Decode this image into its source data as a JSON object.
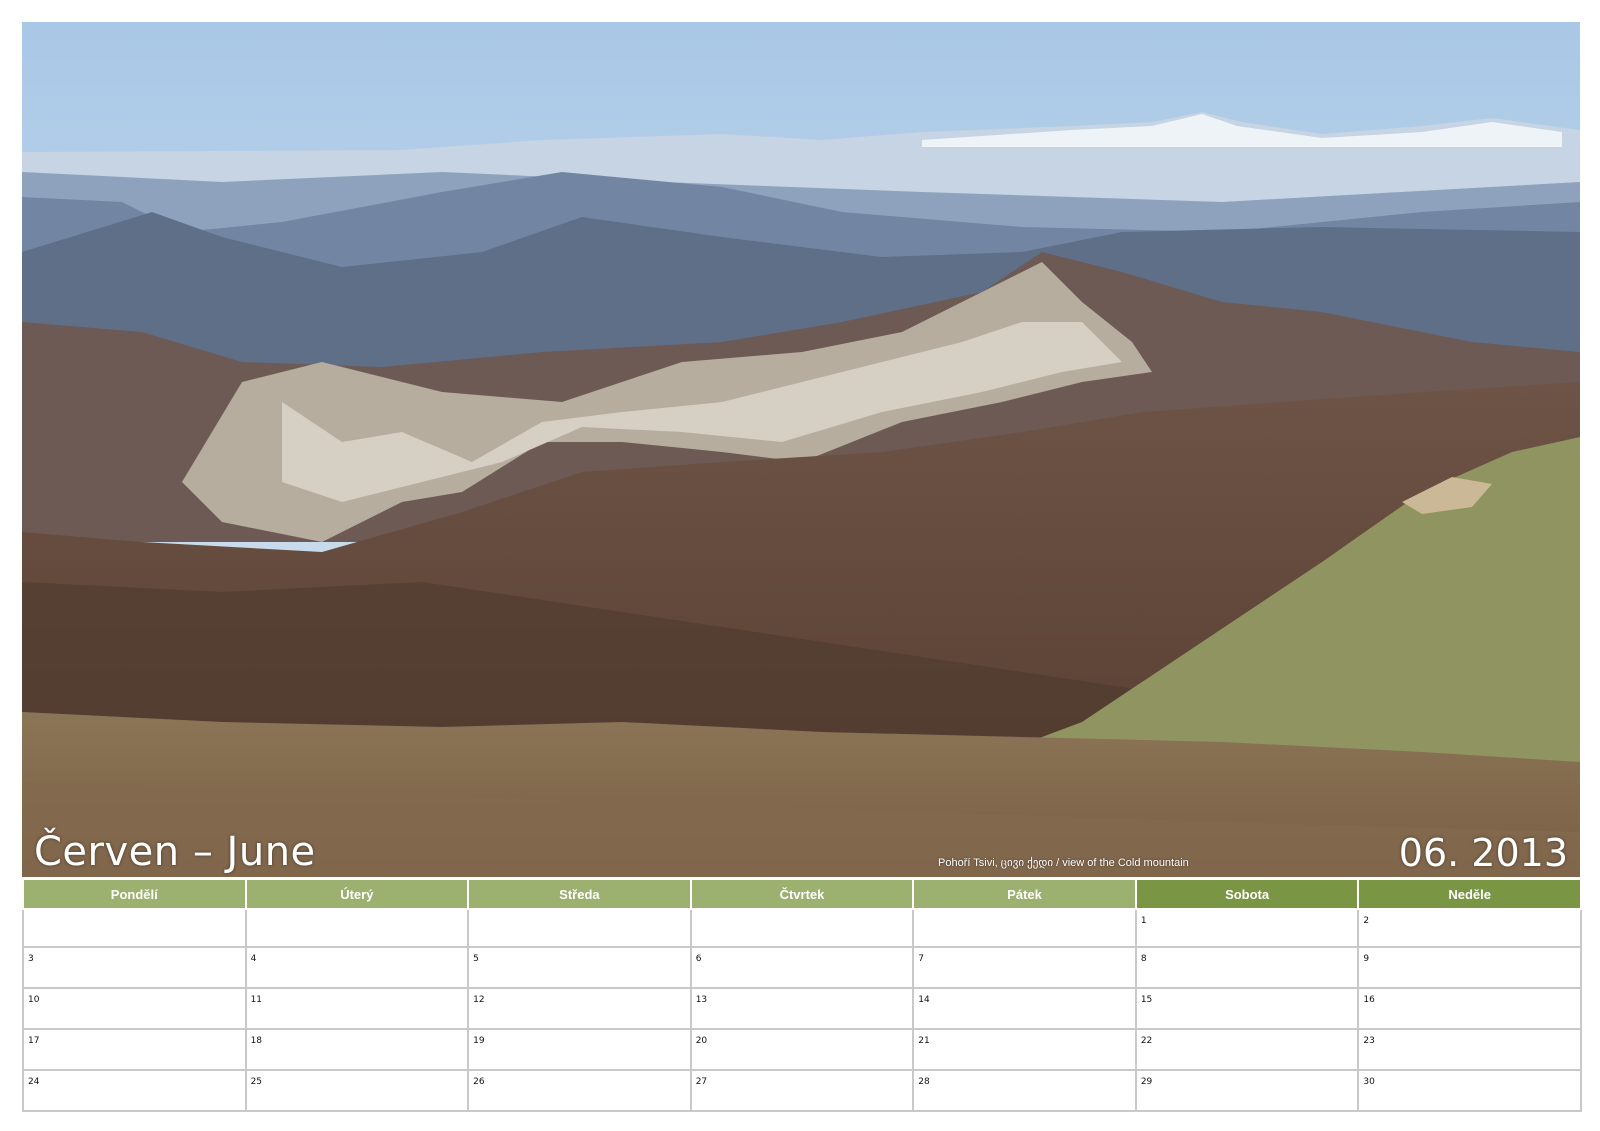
{
  "title": "Červen – June",
  "date": "06. 2013",
  "photo_caption": "Pohoří Tsivi, ცივი ქედი / view  of  the Cold mountain",
  "weekdays": [
    "Pondělí",
    "Úterý",
    "Středa",
    "Čtvrtek",
    "Pátek",
    "Sobota",
    "Neděle"
  ],
  "weeks": [
    [
      "",
      "",
      "",
      "",
      "",
      "1",
      "2"
    ],
    [
      "3",
      "4",
      "5",
      "6",
      "7",
      "8",
      "9"
    ],
    [
      "10",
      "11",
      "12",
      "13",
      "14",
      "15",
      "16"
    ],
    [
      "17",
      "18",
      "19",
      "20",
      "21",
      "22",
      "23"
    ],
    [
      "24",
      "25",
      "26",
      "27",
      "28",
      "29",
      "30"
    ]
  ],
  "colors": {
    "header_weekday": "#9cb06f",
    "header_weekend": "#7a9645",
    "grid": "#c9c9c9"
  }
}
